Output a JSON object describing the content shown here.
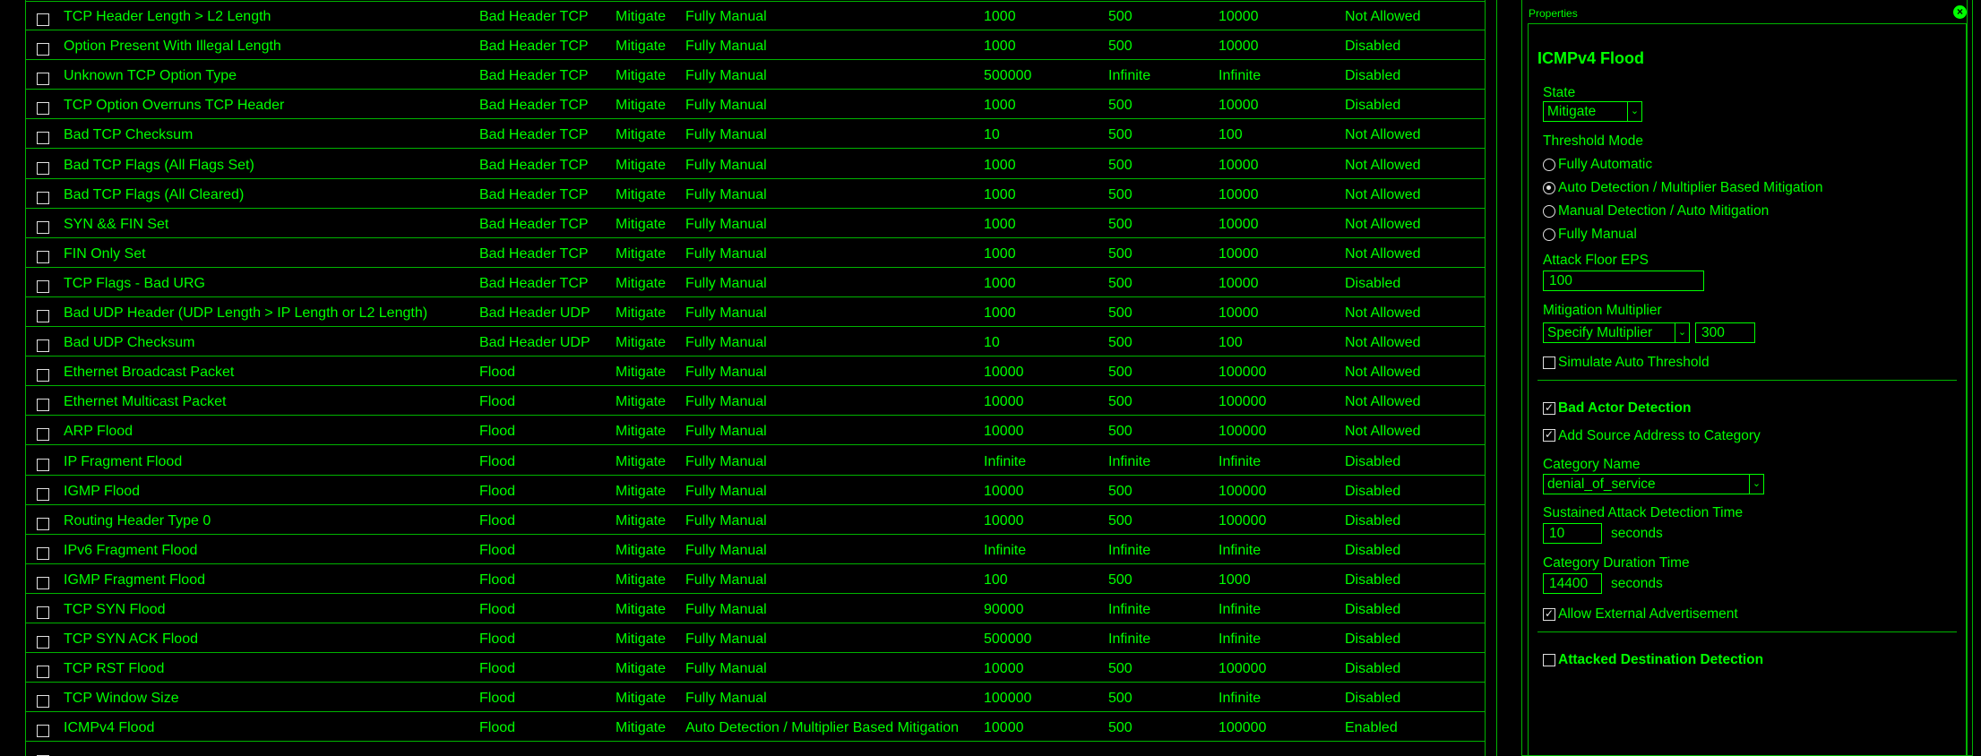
{
  "table": {
    "rows": [
      {
        "name": "TCP Header Length > L2 Length",
        "category": "Bad Header TCP",
        "state": "Mitigate",
        "mode": "Fully Manual",
        "floor": "1000",
        "mult": "500",
        "max": "10000",
        "bad_actor": "Not Allowed"
      },
      {
        "name": "Option Present With Illegal Length",
        "category": "Bad Header TCP",
        "state": "Mitigate",
        "mode": "Fully Manual",
        "floor": "1000",
        "mult": "500",
        "max": "10000",
        "bad_actor": "Disabled"
      },
      {
        "name": "Unknown TCP Option Type",
        "category": "Bad Header TCP",
        "state": "Mitigate",
        "mode": "Fully Manual",
        "floor": "500000",
        "mult": "Infinite",
        "max": "Infinite",
        "bad_actor": "Disabled"
      },
      {
        "name": "TCP Option Overruns TCP Header",
        "category": "Bad Header TCP",
        "state": "Mitigate",
        "mode": "Fully Manual",
        "floor": "1000",
        "mult": "500",
        "max": "10000",
        "bad_actor": "Disabled"
      },
      {
        "name": "Bad TCP Checksum",
        "category": "Bad Header TCP",
        "state": "Mitigate",
        "mode": "Fully Manual",
        "floor": "10",
        "mult": "500",
        "max": "100",
        "bad_actor": "Not Allowed"
      },
      {
        "name": "Bad TCP Flags (All Flags Set)",
        "category": "Bad Header TCP",
        "state": "Mitigate",
        "mode": "Fully Manual",
        "floor": "1000",
        "mult": "500",
        "max": "10000",
        "bad_actor": "Not Allowed"
      },
      {
        "name": "Bad TCP Flags (All Cleared)",
        "category": "Bad Header TCP",
        "state": "Mitigate",
        "mode": "Fully Manual",
        "floor": "1000",
        "mult": "500",
        "max": "10000",
        "bad_actor": "Not Allowed"
      },
      {
        "name": "SYN && FIN Set",
        "category": "Bad Header TCP",
        "state": "Mitigate",
        "mode": "Fully Manual",
        "floor": "1000",
        "mult": "500",
        "max": "10000",
        "bad_actor": "Not Allowed"
      },
      {
        "name": "FIN Only Set",
        "category": "Bad Header TCP",
        "state": "Mitigate",
        "mode": "Fully Manual",
        "floor": "1000",
        "mult": "500",
        "max": "10000",
        "bad_actor": "Not Allowed"
      },
      {
        "name": "TCP Flags - Bad URG",
        "category": "Bad Header TCP",
        "state": "Mitigate",
        "mode": "Fully Manual",
        "floor": "1000",
        "mult": "500",
        "max": "10000",
        "bad_actor": "Disabled"
      },
      {
        "name": "Bad UDP Header (UDP Length > IP Length or L2 Length)",
        "category": "Bad Header UDP",
        "state": "Mitigate",
        "mode": "Fully Manual",
        "floor": "1000",
        "mult": "500",
        "max": "10000",
        "bad_actor": "Not Allowed"
      },
      {
        "name": "Bad UDP Checksum",
        "category": "Bad Header UDP",
        "state": "Mitigate",
        "mode": "Fully Manual",
        "floor": "10",
        "mult": "500",
        "max": "100",
        "bad_actor": "Not Allowed"
      },
      {
        "name": "Ethernet Broadcast Packet",
        "category": "Flood",
        "state": "Mitigate",
        "mode": "Fully Manual",
        "floor": "10000",
        "mult": "500",
        "max": "100000",
        "bad_actor": "Not Allowed"
      },
      {
        "name": "Ethernet Multicast Packet",
        "category": "Flood",
        "state": "Mitigate",
        "mode": "Fully Manual",
        "floor": "10000",
        "mult": "500",
        "max": "100000",
        "bad_actor": "Not Allowed"
      },
      {
        "name": "ARP Flood",
        "category": "Flood",
        "state": "Mitigate",
        "mode": "Fully Manual",
        "floor": "10000",
        "mult": "500",
        "max": "100000",
        "bad_actor": "Not Allowed"
      },
      {
        "name": "IP Fragment Flood",
        "category": "Flood",
        "state": "Mitigate",
        "mode": "Fully Manual",
        "floor": "Infinite",
        "mult": "Infinite",
        "max": "Infinite",
        "bad_actor": "Disabled"
      },
      {
        "name": "IGMP Flood",
        "category": "Flood",
        "state": "Mitigate",
        "mode": "Fully Manual",
        "floor": "10000",
        "mult": "500",
        "max": "100000",
        "bad_actor": "Disabled"
      },
      {
        "name": "Routing Header Type 0",
        "category": "Flood",
        "state": "Mitigate",
        "mode": "Fully Manual",
        "floor": "10000",
        "mult": "500",
        "max": "100000",
        "bad_actor": "Disabled"
      },
      {
        "name": "IPv6 Fragment Flood",
        "category": "Flood",
        "state": "Mitigate",
        "mode": "Fully Manual",
        "floor": "Infinite",
        "mult": "Infinite",
        "max": "Infinite",
        "bad_actor": "Disabled"
      },
      {
        "name": "IGMP Fragment Flood",
        "category": "Flood",
        "state": "Mitigate",
        "mode": "Fully Manual",
        "floor": "100",
        "mult": "500",
        "max": "1000",
        "bad_actor": "Disabled"
      },
      {
        "name": "TCP SYN Flood",
        "category": "Flood",
        "state": "Mitigate",
        "mode": "Fully Manual",
        "floor": "90000",
        "mult": "Infinite",
        "max": "Infinite",
        "bad_actor": "Disabled"
      },
      {
        "name": "TCP SYN ACK Flood",
        "category": "Flood",
        "state": "Mitigate",
        "mode": "Fully Manual",
        "floor": "500000",
        "mult": "Infinite",
        "max": "Infinite",
        "bad_actor": "Disabled"
      },
      {
        "name": "TCP RST Flood",
        "category": "Flood",
        "state": "Mitigate",
        "mode": "Fully Manual",
        "floor": "10000",
        "mult": "500",
        "max": "100000",
        "bad_actor": "Disabled"
      },
      {
        "name": "TCP Window Size",
        "category": "Flood",
        "state": "Mitigate",
        "mode": "Fully Manual",
        "floor": "100000",
        "mult": "500",
        "max": "Infinite",
        "bad_actor": "Disabled"
      },
      {
        "name": "ICMPv4 Flood",
        "category": "Flood",
        "state": "Mitigate",
        "mode": "Auto Detection / Multiplier Based Mitigation",
        "floor": "10000",
        "mult": "500",
        "max": "100000",
        "bad_actor": "Enabled"
      }
    ]
  },
  "panel": {
    "header": "Properties",
    "title": "ICMPv4 Flood",
    "state_label": "State",
    "state_value": "Mitigate",
    "threshold_label": "Threshold Mode",
    "threshold_options": [
      {
        "label": "Fully Automatic",
        "selected": false
      },
      {
        "label": "Auto Detection / Multiplier Based Mitigation",
        "selected": true
      },
      {
        "label": "Manual Detection / Auto Mitigation",
        "selected": false
      },
      {
        "label": "Fully Manual",
        "selected": false
      }
    ],
    "floor_label": "Attack Floor EPS",
    "floor_value": "100",
    "mult_label": "Mitigation Multiplier",
    "mult_select": "Specify Multiplier",
    "mult_value": "300",
    "simulate_label": "Simulate Auto Threshold",
    "simulate_checked": false,
    "bad_actor_label": "Bad Actor Detection",
    "bad_actor_checked": true,
    "add_source_label": "Add Source Address to Category",
    "add_source_checked": true,
    "category_label": "Category Name",
    "category_value": "denial_of_service",
    "sustained_label": "Sustained Attack Detection Time",
    "sustained_value": "10",
    "sustained_unit": "seconds",
    "duration_label": "Category Duration Time",
    "duration_value": "14400",
    "duration_unit": "seconds",
    "external_label": "Allow External Advertisement",
    "external_checked": true,
    "attacked_label": "Attacked Destination Detection",
    "attacked_checked": false
  }
}
